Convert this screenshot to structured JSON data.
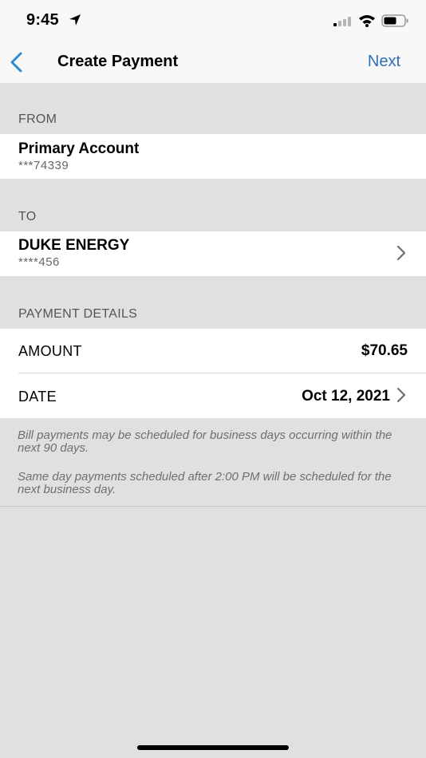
{
  "status_bar": {
    "time": "9:45"
  },
  "nav": {
    "back_icon": "chevron-left-icon",
    "title": "Create Payment",
    "next_label": "Next",
    "accent_color": "#2f6fb4"
  },
  "from": {
    "header": "FROM",
    "account_name": "Primary Account",
    "account_number": "***74339"
  },
  "to": {
    "header": "TO",
    "payee_name": "DUKE ENERGY",
    "payee_number": "****456"
  },
  "details": {
    "header": "PAYMENT DETAILS",
    "amount_label": "AMOUNT",
    "amount_value": "$70.65",
    "date_label": "DATE",
    "date_value": "Oct 12, 2021"
  },
  "notes": [
    "Bill payments may be scheduled for business days occurring within the next 90 days.",
    "Same day payments scheduled after 2:00 PM will be scheduled for the next business day."
  ]
}
